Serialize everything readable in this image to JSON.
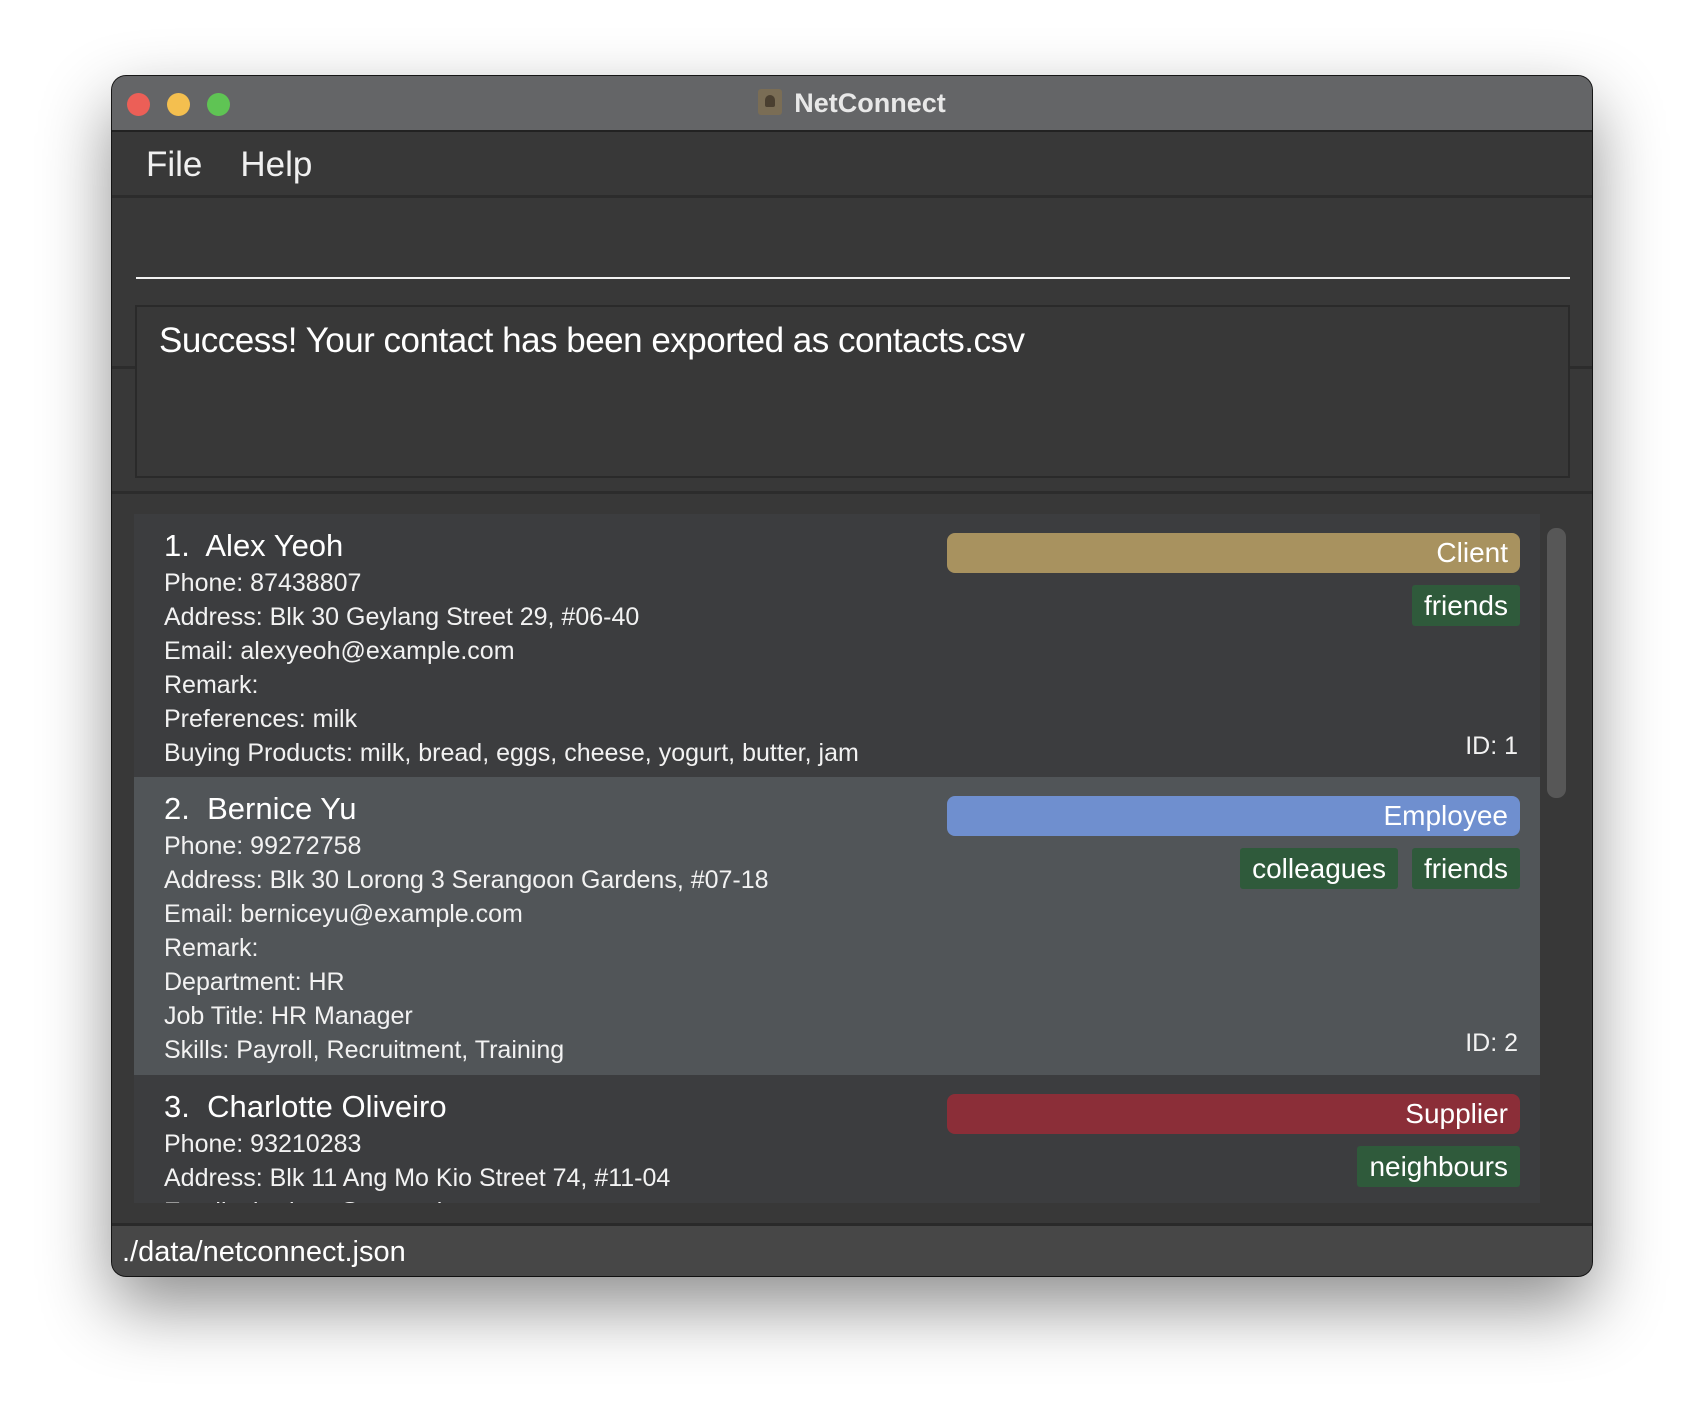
{
  "window": {
    "title": "NetConnect",
    "traffic_lights": {
      "close": "#ec5f57",
      "minimize": "#f4bf4f",
      "zoom": "#5fc454"
    }
  },
  "menu": {
    "items": [
      {
        "label": "File"
      },
      {
        "label": "Help"
      }
    ]
  },
  "command": {
    "value": ""
  },
  "result": {
    "text": "Success! Your contact has been exported as contacts.csv"
  },
  "contacts": [
    {
      "index": "1.",
      "name": "Alex Yeoh",
      "role": "Client",
      "role_color": "#a8925f",
      "tags": [
        "friends"
      ],
      "fields": [
        "Phone: 87438807",
        "Address: Blk 30 Geylang Street 29, #06-40",
        "Email: alexyeoh@example.com",
        "Remark:",
        "Preferences: milk",
        "Buying Products: milk, bread, eggs, cheese, yogurt, butter, jam"
      ],
      "id": "ID: 1"
    },
    {
      "index": "2.",
      "name": "Bernice Yu",
      "role": "Employee",
      "role_color": "#6f8fcf",
      "tags": [
        "colleagues",
        "friends"
      ],
      "fields": [
        "Phone: 99272758",
        "Address: Blk 30 Lorong 3 Serangoon Gardens, #07-18",
        "Email: berniceyu@example.com",
        "Remark:",
        "Department: HR",
        "Job Title: HR Manager",
        "Skills: Payroll, Recruitment, Training"
      ],
      "id": "ID: 2"
    },
    {
      "index": "3.",
      "name": "Charlotte Oliveiro",
      "role": "Supplier",
      "role_color": "#8b2e38",
      "tags": [
        "neighbours"
      ],
      "fields": [
        "Phone: 93210283",
        "Address: Blk 11 Ang Mo Kio Street 74, #11-04",
        "Email: charlotte@example.com"
      ]
    }
  ],
  "status": {
    "path": "./data/netconnect.json"
  }
}
